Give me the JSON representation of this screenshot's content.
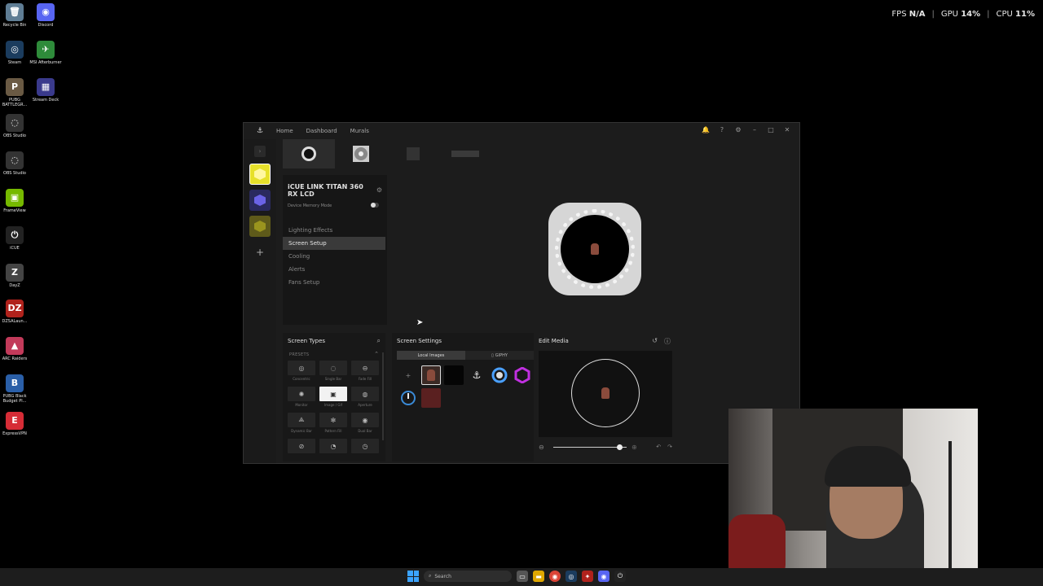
{
  "desktop": {
    "icons": [
      {
        "label": "Recycle Bin",
        "color": "#5f7d94",
        "glyph": "🗑"
      },
      {
        "label": "Discord",
        "color": "#5865f2",
        "glyph": "◉"
      },
      {
        "label": "Steam",
        "color": "#1b3c5e",
        "glyph": "◎"
      },
      {
        "label": "MSI Afterburner",
        "color": "#2e8b3a",
        "glyph": "✈"
      },
      {
        "label": "PUBG BATTLEGR...",
        "color": "#6a5a44",
        "glyph": "P"
      },
      {
        "label": "Stream Deck",
        "color": "#3a3a8c",
        "glyph": "▦"
      },
      {
        "label": "OBS Studio",
        "color": "#333333",
        "glyph": "◌"
      },
      {
        "label": "OBS Studio",
        "color": "#333333",
        "glyph": "◌"
      },
      {
        "label": "FrameView",
        "color": "#76b900",
        "glyph": "▣"
      },
      {
        "label": "iCUE",
        "color": "#222222",
        "glyph": "⏻"
      },
      {
        "label": "DayZ",
        "color": "#444444",
        "glyph": "Z"
      },
      {
        "label": "DZSALaun...",
        "color": "#b0221c",
        "glyph": "DZ"
      },
      {
        "label": "ARC Raiders",
        "color": "#c23a5a",
        "glyph": "▲"
      },
      {
        "label": "PUBG Black Budget Pl...",
        "color": "#2a5fa8",
        "glyph": "B"
      },
      {
        "label": "ExpressVPN",
        "color": "#d62c36",
        "glyph": "E"
      }
    ]
  },
  "overlay": {
    "fps_label": "FPS",
    "fps_value": "N/A",
    "gpu_label": "GPU",
    "gpu_value": "14",
    "cpu_label": "CPU",
    "cpu_value": "11",
    "pct": "%",
    "sep": "|"
  },
  "window": {
    "nav": {
      "home": "Home",
      "dashboard": "Dashboard",
      "murals": "Murals"
    },
    "device": {
      "name": "iCUE LINK TITAN 360 RX LCD",
      "memory_mode": "Device Memory Mode"
    },
    "menu": [
      "Lighting Effects",
      "Screen Setup",
      "Cooling",
      "Alerts",
      "Fans Setup"
    ],
    "active_menu_index": 1,
    "screen_types": {
      "title": "Screen Types",
      "presets_label": "PRESETS",
      "items": [
        {
          "label": "Concentric",
          "icon": "◎"
        },
        {
          "label": "Single Bar",
          "icon": "◌"
        },
        {
          "label": "Fade Fill",
          "icon": "⊖"
        },
        {
          "label": "Monitor",
          "icon": "✺"
        },
        {
          "label": "Image / Gif",
          "icon": "▣"
        },
        {
          "label": "Aperture",
          "icon": "◍"
        },
        {
          "label": "Dynamic Bar",
          "icon": "⟁"
        },
        {
          "label": "Pattern Fill",
          "icon": "✻"
        },
        {
          "label": "Dual Bar",
          "icon": "◉"
        },
        {
          "label": "",
          "icon": "⊘"
        },
        {
          "label": "",
          "icon": "◔"
        },
        {
          "label": "",
          "icon": "◷"
        }
      ],
      "active_index": 4
    },
    "screen_settings": {
      "title": "Screen Settings",
      "tab_local": "Local Images",
      "tab_giphy": "GIPHY"
    },
    "edit_media": {
      "title": "Edit Media",
      "zoom_level": 0.9
    }
  },
  "taskbar": {
    "search_placeholder": "Search"
  }
}
